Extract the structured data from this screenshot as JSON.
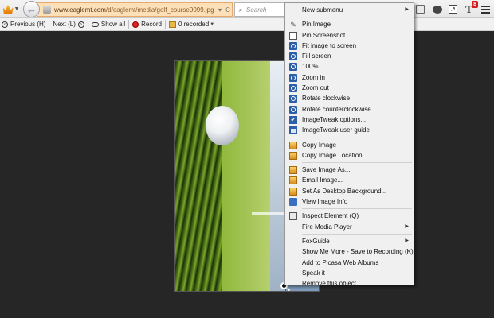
{
  "navbar": {
    "url_domain": "www.eaglemt.com",
    "url_path": "/d/eaglemt/media/golf_course0099.jpg",
    "url_reload_glyph": "C",
    "url_dropmarker_glyph": "▾",
    "search_placeholder": "Search",
    "notification_badge": "8"
  },
  "viewer_toolbar": {
    "previous": "Previous (H)",
    "next": "Next (L)",
    "show_all": "Show all",
    "record": "Record",
    "recorded": "0 recorded"
  },
  "context_menu": {
    "groups": [
      [
        {
          "label": "New submenu",
          "submenu": true,
          "icon": ""
        }
      ],
      [
        {
          "label": "Pin Image",
          "icon": "pin-icon"
        },
        {
          "label": "Pin Screenshot",
          "icon": "screenshot-icon"
        },
        {
          "label": "Fit image to screen",
          "icon": "zoom-icon"
        },
        {
          "label": "Fill screen",
          "icon": "zoom-icon"
        },
        {
          "label": "100%",
          "icon": "zoom-icon"
        },
        {
          "label": "Zoom in",
          "icon": "zoom-icon"
        },
        {
          "label": "Zoom out",
          "icon": "zoom-icon"
        },
        {
          "label": "Rotate clockwise",
          "icon": "rotate-icon"
        },
        {
          "label": "Rotate counterclockwise",
          "icon": "rotate-icon"
        },
        {
          "label": "ImageTweak options...",
          "icon": "checkmark-icon"
        },
        {
          "label": "ImageTweak user guide",
          "icon": "guide-icon"
        }
      ],
      [
        {
          "label": "Copy Image",
          "icon": "image-icon"
        },
        {
          "label": "Copy Image Location",
          "icon": "image-icon"
        }
      ],
      [
        {
          "label": "Save Image As...",
          "icon": "image-icon"
        },
        {
          "label": "Email Image...",
          "icon": "image-icon"
        },
        {
          "label": "Set As Desktop Background...",
          "icon": "image-icon"
        },
        {
          "label": "View Image Info",
          "icon": "info-icon"
        }
      ],
      [
        {
          "label": "Inspect Element (Q)",
          "icon": "inspect-icon"
        },
        {
          "label": "Fire Media Player",
          "submenu": true,
          "icon": ""
        }
      ],
      [
        {
          "label": "FoxGuide",
          "submenu": true,
          "icon": ""
        },
        {
          "label": "Show Me More - Save to Recording (K)",
          "icon": ""
        },
        {
          "label": "Add to Picasa Web Albums",
          "icon": ""
        },
        {
          "label": "Speak it",
          "icon": ""
        },
        {
          "label": "Remove this object",
          "icon": ""
        }
      ]
    ]
  }
}
